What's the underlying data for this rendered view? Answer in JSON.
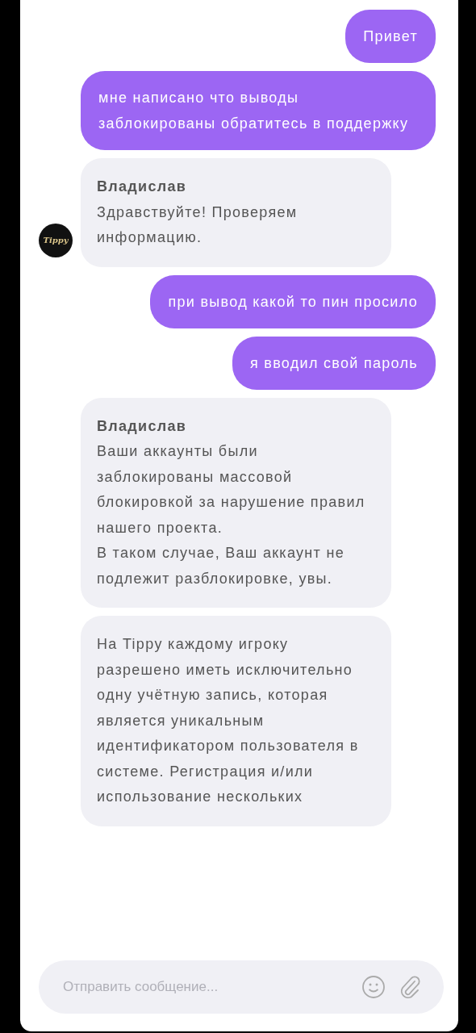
{
  "messages": [
    {
      "kind": "outgoing",
      "text": "Привет"
    },
    {
      "kind": "outgoing",
      "text": "мне написано что выводы заблокированы обратитесь в поддержку"
    },
    {
      "kind": "incoming",
      "avatar": true,
      "author": "Владислав",
      "text": "Здравствуйте! Проверяем информацию."
    },
    {
      "kind": "outgoing",
      "text": "при вывод какой то пин просило"
    },
    {
      "kind": "outgoing",
      "text": "я вводил свой пароль"
    },
    {
      "kind": "incoming",
      "avatar": false,
      "author": "Владислав",
      "text": "Ваши аккаунты были заблокированы массовой блокировкой за нарушение правил нашего проекта.\nВ таком случае, Ваш аккаунт не подлежит разблокировке, увы."
    },
    {
      "kind": "incoming",
      "avatar": false,
      "text": "На Tippy каждому игроку разрешено иметь исключительно одну учётную запись, которая является уникальным идентификатором пользователя в системе. Регистрация и/или использование нескольких"
    }
  ],
  "avatar_logo": "Tippy",
  "composer": {
    "placeholder": "Отправить сообщение..."
  }
}
